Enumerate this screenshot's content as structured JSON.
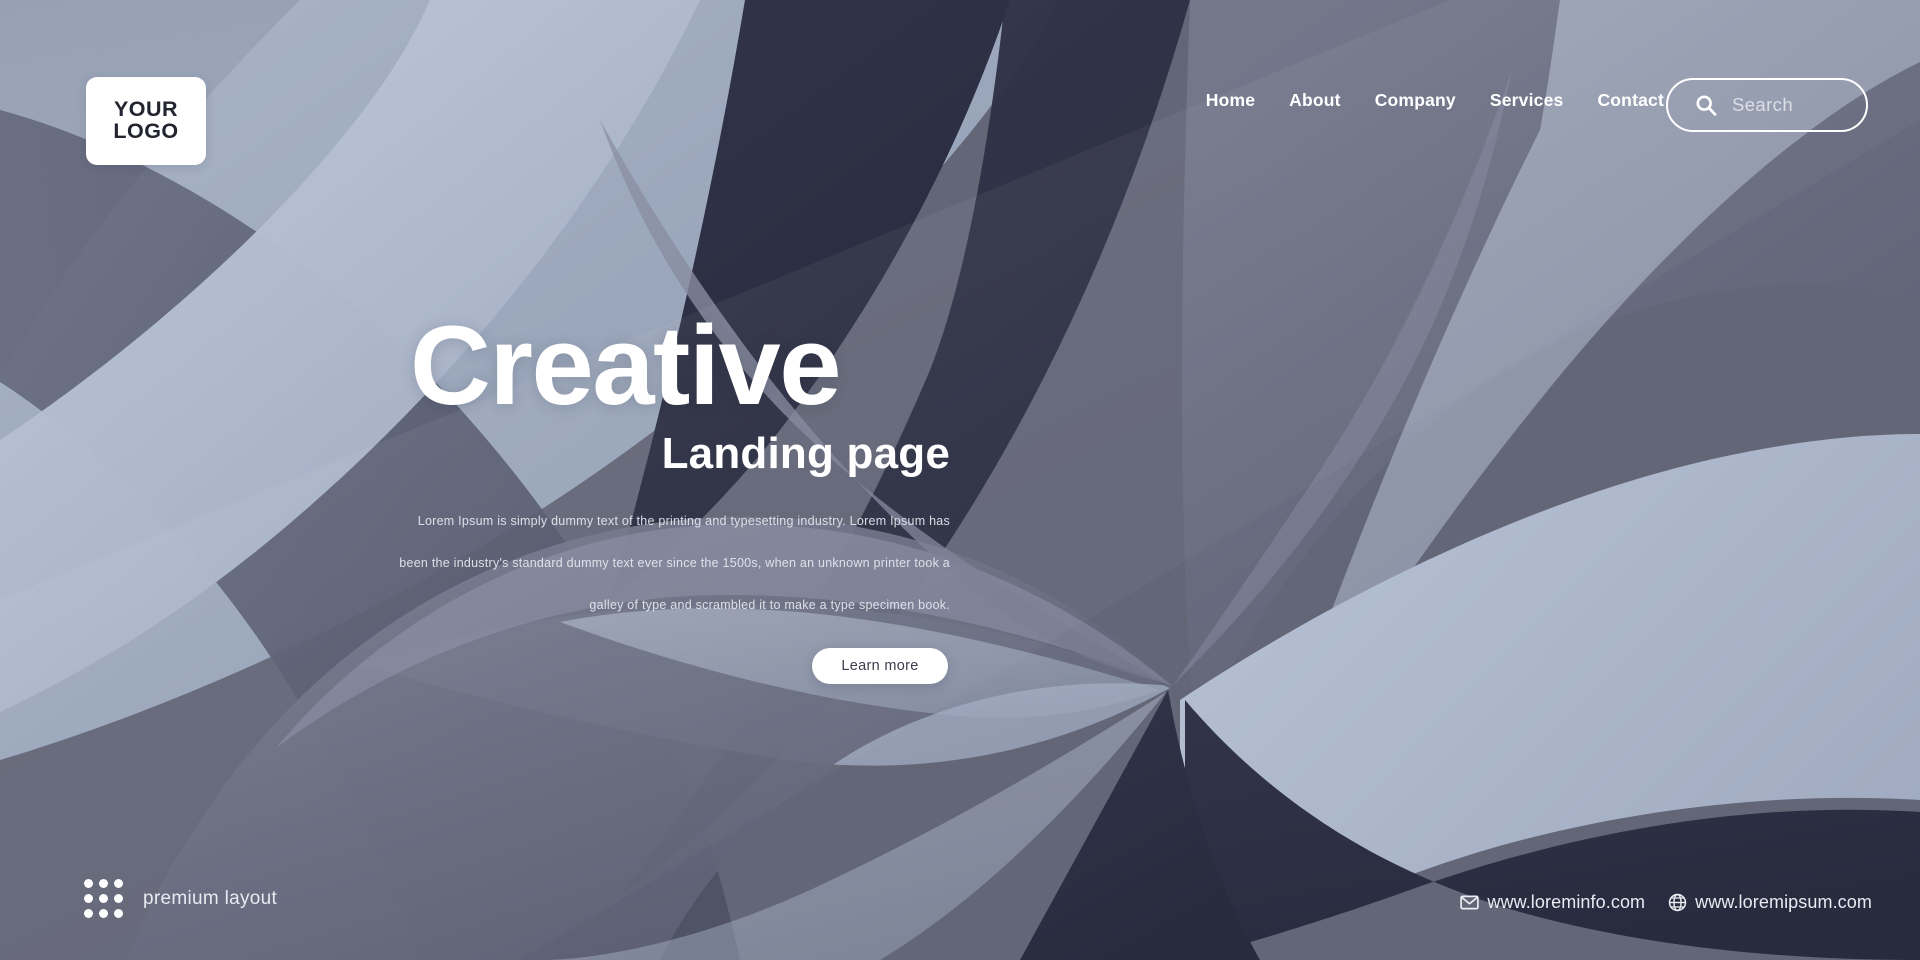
{
  "brand": {
    "logo_line1": "YOUR",
    "logo_line2": "LOGO"
  },
  "nav": {
    "items": [
      {
        "label": "Home"
      },
      {
        "label": "About"
      },
      {
        "label": "Company"
      },
      {
        "label": "Services"
      },
      {
        "label": "Contact"
      }
    ]
  },
  "search": {
    "placeholder": "Search",
    "value": "",
    "icon": "search-icon"
  },
  "hero": {
    "title": "Creative",
    "subtitle": "Landing page",
    "body_line1": "Lorem Ipsum is simply dummy text of the printing and typesetting industry. Lorem Ipsum has",
    "body_line2": "been the industry's standard dummy text ever since the 1500s, when an unknown printer took a",
    "body_line3": "galley of type and scrambled it to make a type specimen book.",
    "cta_label": "Learn more"
  },
  "footer": {
    "premium_label": "premium layout",
    "grid_icon": "dot-grid-icon",
    "contacts": [
      {
        "icon": "envelope-icon",
        "text": "www.loreminfo.com"
      },
      {
        "icon": "globe-icon",
        "text": "www.loremipsum.com"
      }
    ]
  },
  "colors": {
    "base_gray": "#636677",
    "light_blue": "#9aa7bd",
    "pale_blue": "#b9c4d6",
    "dark_navy": "#2d2f44",
    "mid_slate": "#5b5e72",
    "white": "#ffffff"
  }
}
